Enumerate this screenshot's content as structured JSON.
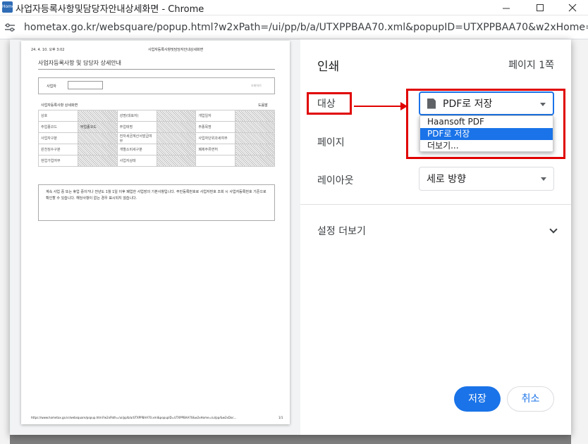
{
  "window": {
    "title": "사업자등록사항및담당자안내상세화면 - Chrome",
    "app_icon_label": "Home",
    "url": "hometax.go.kr/websquare/popup.html?w2xPath=/ui/pp/b/a/UTXPPBAA70.xml&popupID=UTXPPBAA70&w2xHome=/ui/p..."
  },
  "preview": {
    "header_date": "24. 4. 10. 오후 3:02",
    "header_title": "사업자등록사항및담당자안내상세화면",
    "doc_title": "사업자등록사항 및 담당자 상세안내",
    "biz_label": "사업자",
    "biz_button": "조회하기",
    "section_title": "사업자등록사항 상세화면",
    "help": "도움말",
    "rows": [
      [
        "상호",
        "",
        "성명(대표자)",
        "",
        "개업일자",
        ""
      ],
      [
        "주업종코드",
        "부업종코드",
        "주업태명",
        "",
        "주종목명",
        ""
      ],
      [
        "사업자구분",
        "",
        "전자세금계산서발급여부",
        "",
        "사업자단위과세여부",
        ""
      ],
      [
        "원천징수구분",
        "",
        "개별소비세구분",
        "",
        "폐제주류면허",
        ""
      ],
      [
        "현업가업여부",
        "",
        "사업자상태",
        "",
        "",
        ""
      ]
    ],
    "notice": "계속 사업 중 또는 휴업 중이거나 전년도 1월 1일 이후 폐업한 사업장의 기본사항입니다. 주민등록번호로 사업자번호 조회 시 사업자등록번호 기준으로 확인할 수 있습니다. 해당사항이 없는 경우 표시되지 않습니다.",
    "footer_url": "https://www.hometax.go.kr/websquare/popup.html?w2xPath=/ui/pp/b/a/UTXPPBAA70.xml&popupID=UTXPPBAA70&w2xHome=/ui/pp/&w2xDoc...",
    "footer_page": "1/1"
  },
  "settings": {
    "title": "인쇄",
    "page_count": "페이지 1쪽",
    "destination_label": "대상",
    "destination_value": "PDF로 저장",
    "destination_options": [
      "Haansoft PDF",
      "PDF로 저장",
      "더보기..."
    ],
    "pages_label": "페이지",
    "layout_label": "레이아웃",
    "layout_value": "세로 방향",
    "more_settings": "설정 더보기",
    "save_button": "저장",
    "cancel_button": "취소"
  },
  "colors": {
    "accent": "#1a73e8",
    "annotation": "#e00000"
  }
}
